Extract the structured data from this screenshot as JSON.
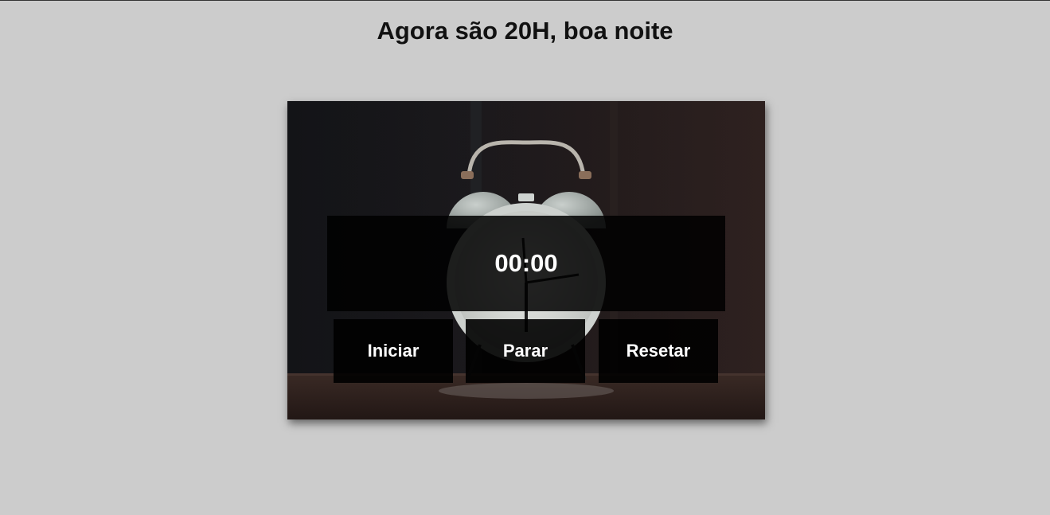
{
  "greeting": "Agora são 20H, boa noite",
  "timer": {
    "display": "00:00"
  },
  "controls": {
    "start_label": "Iniciar",
    "stop_label": "Parar",
    "reset_label": "Resetar"
  },
  "colors": {
    "page_background": "#cccccc",
    "overlay": "#000000",
    "text_light": "#ffffff",
    "text_dark": "#111111"
  },
  "icons": {
    "background_image": "alarm-clock-photo"
  }
}
